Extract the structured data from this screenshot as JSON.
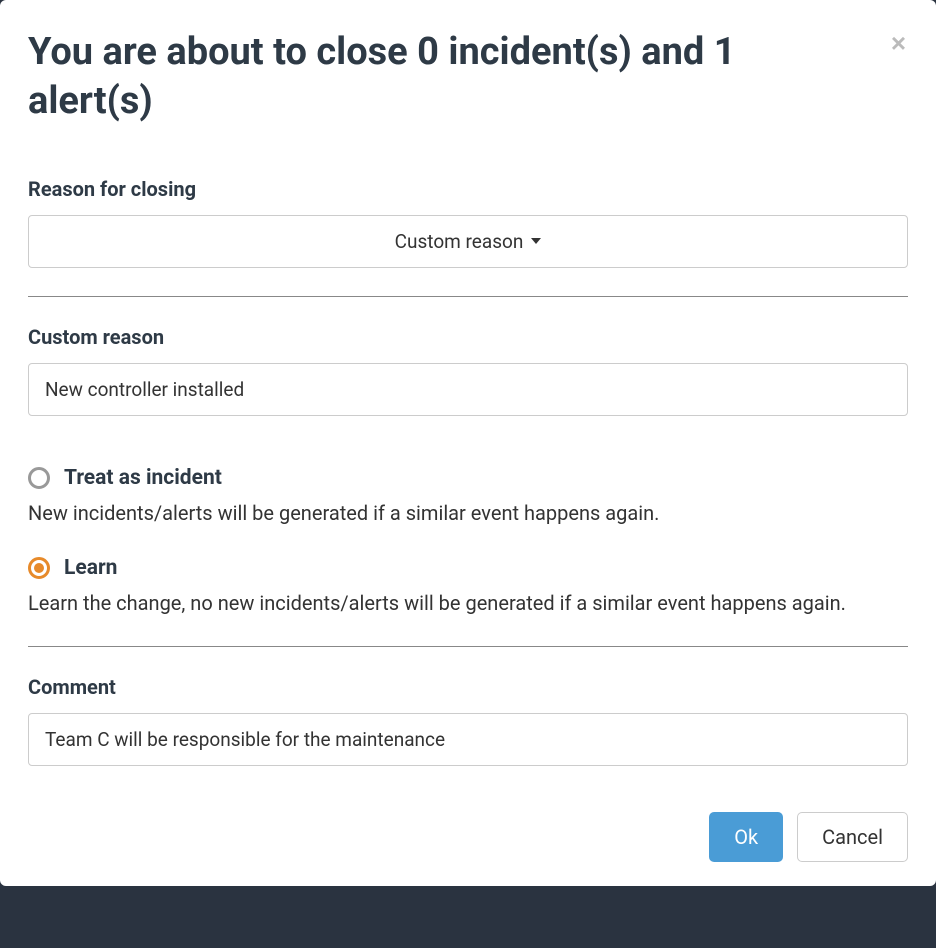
{
  "modal": {
    "title": "You are about to close 0 incident(s) and 1 alert(s)",
    "reason_label": "Reason for closing",
    "reason_selected": "Custom reason",
    "custom_reason_label": "Custom reason",
    "custom_reason_value": "New controller installed",
    "radio_options": [
      {
        "label": "Treat as incident",
        "description": "New incidents/alerts will be generated if a similar event happens again.",
        "selected": false
      },
      {
        "label": "Learn",
        "description": "Learn the change, no new incidents/alerts will be generated if a similar event happens again.",
        "selected": true
      }
    ],
    "comment_label": "Comment",
    "comment_value": "Team C will be responsible for the maintenance",
    "ok_label": "Ok",
    "cancel_label": "Cancel"
  }
}
